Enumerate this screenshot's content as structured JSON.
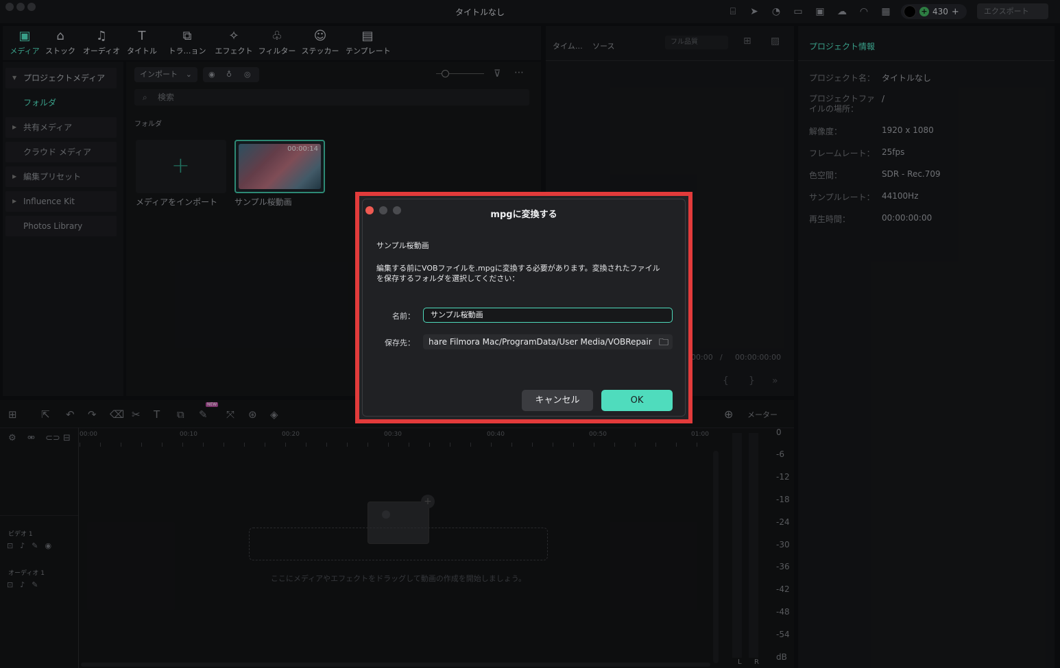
{
  "window": {
    "title": "タイトルなし"
  },
  "topbar": {
    "credits": "430",
    "export_label": "エクスポート",
    "credits_plus": "+"
  },
  "tabs": [
    {
      "label": "メディア",
      "icon": "media-icon"
    },
    {
      "label": "ストック",
      "icon": "stock-icon"
    },
    {
      "label": "オーディオ",
      "icon": "audio-icon"
    },
    {
      "label": "タイトル",
      "icon": "title-icon"
    },
    {
      "label": "トラ…ョン",
      "icon": "transition-icon"
    },
    {
      "label": "エフェクト",
      "icon": "effect-icon"
    },
    {
      "label": "フィルター",
      "icon": "filter-icon"
    },
    {
      "label": "ステッカー",
      "icon": "sticker-icon"
    },
    {
      "label": "テンプレート",
      "icon": "template-icon"
    }
  ],
  "sidebar": {
    "items": [
      {
        "label": "プロジェクトメディア"
      },
      {
        "label": "フォルダ"
      },
      {
        "label": "共有メディア"
      },
      {
        "label": "クラウド メディア"
      },
      {
        "label": "編集プリセット"
      },
      {
        "label": "Influence Kit"
      },
      {
        "label": "Photos Library"
      }
    ]
  },
  "media": {
    "import_label": "インポート",
    "search_placeholder": "検索",
    "folder_label": "フォルダ",
    "import_tile_label": "メディアをインポート",
    "clip_label": "サンプル桜動画",
    "clip_duration": "00:00:14"
  },
  "preview": {
    "tab_timeline": "タイム…",
    "tab_source": "ソース",
    "quality": "フル品質",
    "time_current": "00:00",
    "time_sep": "/",
    "time_total": "00:00:00:00"
  },
  "project_info": {
    "title": "プロジェクト情報",
    "rows": [
      {
        "label": "プロジェクト名：",
        "value": "タイトルなし"
      },
      {
        "label": "プロジェクトファイルの場所：",
        "value": "/"
      },
      {
        "label": "解像度：",
        "value": "1920 x 1080"
      },
      {
        "label": "フレームレート：",
        "value": "25fps"
      },
      {
        "label": "色空間：",
        "value": "SDR - Rec.709"
      },
      {
        "label": "サンプルレート：",
        "value": "44100Hz"
      },
      {
        "label": "再生時間：",
        "value": "00:00:00:00"
      }
    ]
  },
  "timeline": {
    "ruler": [
      "00:00",
      "00:10",
      "00:20",
      "00:30",
      "00:40",
      "00:50",
      "01:00"
    ],
    "track_video": "ビデオ 1",
    "track_audio": "オーディオ 1",
    "drop_hint": "ここにメディアやエフェクトをドラッグして動画の作成を開始しましょう。",
    "meter_label": "メーター",
    "meter_scale": [
      "0",
      "-6",
      "-12",
      "-18",
      "-24",
      "-30",
      "-36",
      "-42",
      "-48",
      "-54",
      "dB"
    ],
    "meter_l": "L",
    "meter_r": "R",
    "new_badge": "NEW"
  },
  "dialog": {
    "title": "mpgに変換する",
    "file_name": "サンプル桜動画",
    "message_line1": "編集する前にVOBファイルを.mpgに変換する必要があります。変換されたファイル",
    "message_line2": "を保存するフォルダを選択してください：",
    "name_label": "名前：",
    "name_value": "サンプル桜動画",
    "save_label": "保存先：",
    "save_path": "hare Filmora Mac/ProgramData/User Media/VOBRepair",
    "cancel_label": "キャンセル",
    "ok_label": "OK",
    "highlight_color": "#e23b3b",
    "accent_color": "#4fdcbd"
  }
}
